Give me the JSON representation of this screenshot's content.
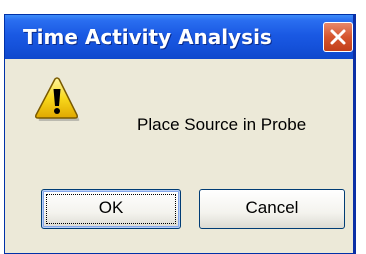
{
  "dialog": {
    "title": "Time Activity Analysis",
    "message": "Place Source in Probe",
    "icon": "warning-icon",
    "buttons": {
      "ok_label": "OK",
      "cancel_label": "Cancel"
    }
  },
  "colors": {
    "title_bar": "#1a59e3",
    "close_button": "#d6552e",
    "dialog_background": "#ece9d8",
    "warning_yellow": "#f8d81c"
  }
}
